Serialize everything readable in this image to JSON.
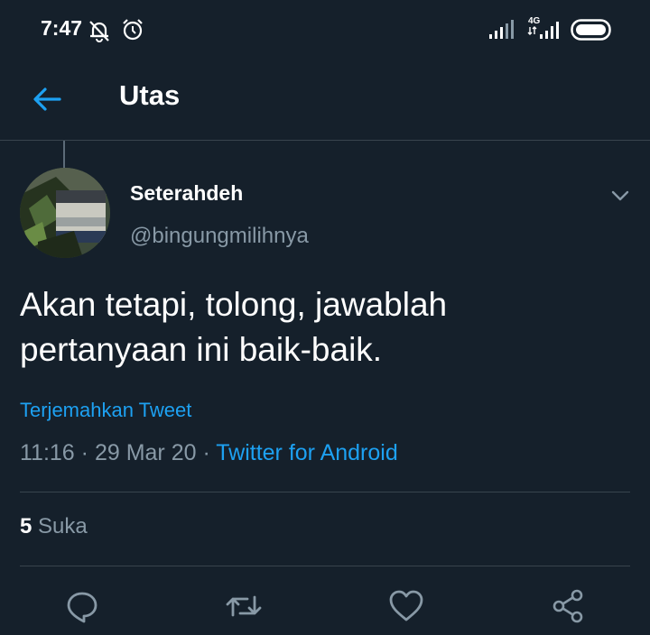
{
  "status_bar": {
    "time": "7:47",
    "network": "4G",
    "icons": [
      "notifications-off-icon",
      "alarm-icon",
      "signal-icon",
      "signal-4g-icon",
      "battery-icon"
    ]
  },
  "header": {
    "title": "Utas",
    "back_icon": "back-arrow-icon"
  },
  "tweet": {
    "author": {
      "display_name": "Seterahdeh",
      "handle": "@bingungmilihnya"
    },
    "text_lines": [
      "Akan tetapi, tolong, jawablah",
      "pertanyaan ini baik-baik."
    ],
    "translate_label": "Terjemahkan Tweet",
    "time": "11:16",
    "separator": " · ",
    "date": "29 Mar 20",
    "source": "Twitter for Android",
    "likes": {
      "count": "5",
      "label": "Suka"
    },
    "actions": [
      "reply-icon",
      "retweet-icon",
      "like-icon",
      "share-icon"
    ]
  },
  "colors": {
    "background": "#15202b",
    "accent": "#1da1f2",
    "secondary_text": "#8899a6",
    "divider": "#38444d"
  }
}
